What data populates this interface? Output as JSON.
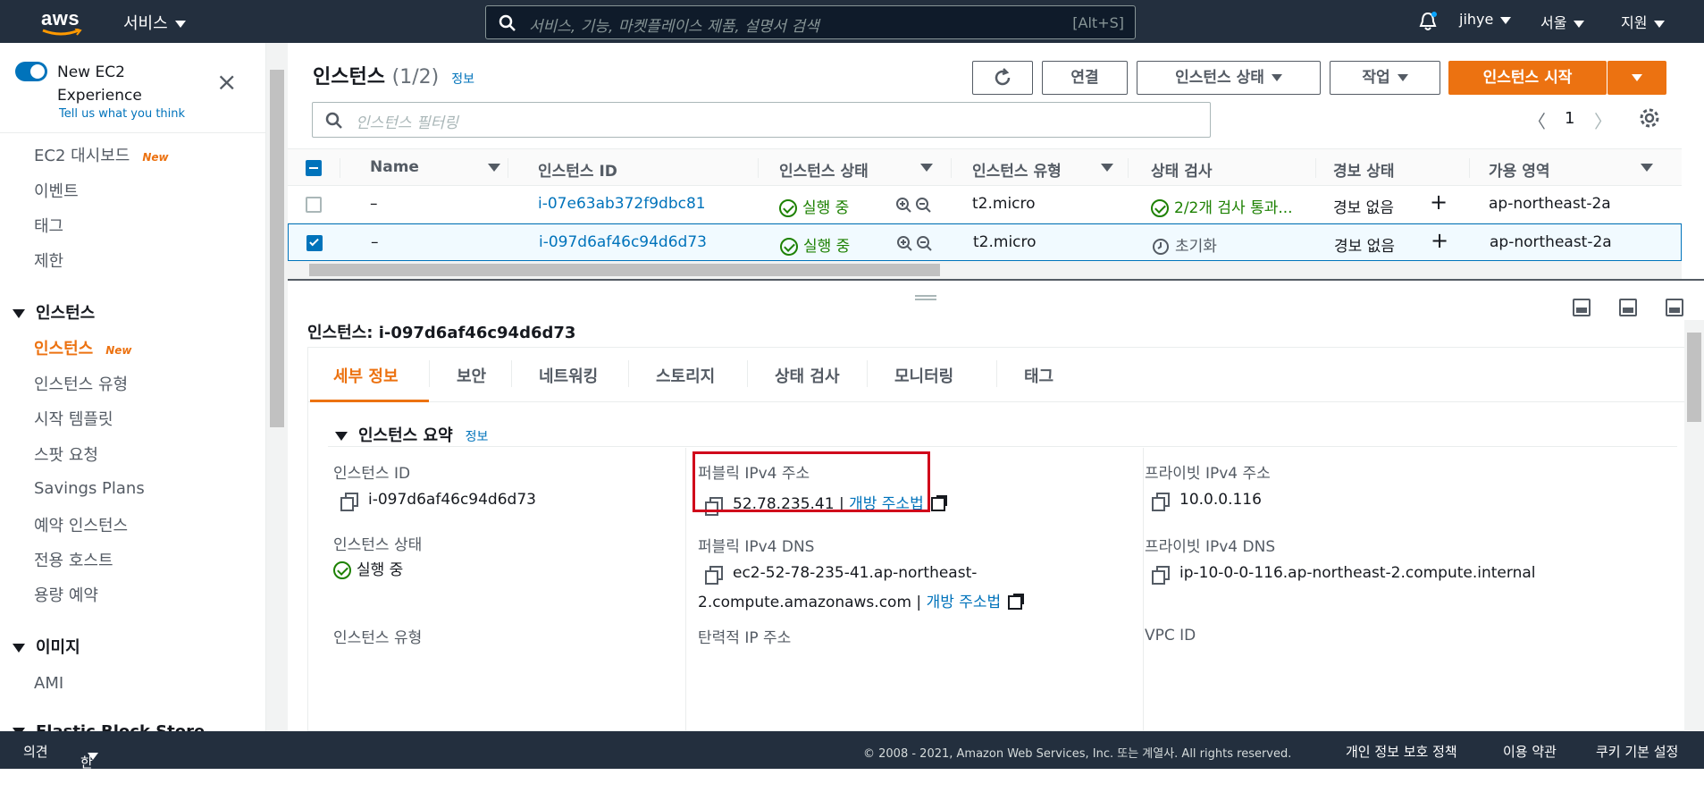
{
  "topbar": {
    "logo": "aws",
    "services_label": "서비스",
    "search_placeholder": "서비스, 기능, 마켓플레이스 제품, 설명서 검색",
    "search_shortcut": "[Alt+S]",
    "user": "jihye",
    "region": "서울",
    "support": "지원"
  },
  "sidebar": {
    "new_ec2": "New EC2 Experience",
    "tell_us": "Tell us what you think",
    "items": [
      {
        "label": "EC2 대시보드",
        "badge": "New"
      },
      {
        "label": "이벤트"
      },
      {
        "label": "태그"
      },
      {
        "label": "제한"
      }
    ],
    "section_instances": "인스턴스",
    "instance_items": [
      {
        "label": "인스턴스",
        "badge": "New"
      },
      {
        "label": "인스턴스 유형"
      },
      {
        "label": "시작 템플릿"
      },
      {
        "label": "스팟 요청"
      },
      {
        "label": "Savings Plans"
      },
      {
        "label": "예약 인스턴스"
      },
      {
        "label": "전용 호스트"
      },
      {
        "label": "용량 예약"
      }
    ],
    "section_images": "이미지",
    "image_items": [
      {
        "label": "AMI"
      }
    ],
    "section_ebs": "Elastic Block Store"
  },
  "main": {
    "title": "인스턴스",
    "count": "(1/2)",
    "info": "정보",
    "buttons": {
      "connect": "연결",
      "instance_state": "인스턴스 상태",
      "actions": "작업",
      "launch": "인스턴스 시작"
    },
    "filter_placeholder": "인스턴스 필터링",
    "page": "1",
    "columns": [
      "Name",
      "인스턴스 ID",
      "인스턴스 상태",
      "인스턴스 유형",
      "상태 검사",
      "경보 상태",
      "가용 영역"
    ],
    "rows": [
      {
        "name": "–",
        "id": "i-07e63ab372f9dbc81",
        "state": "실행 중",
        "type": "t2.micro",
        "check": "2/2개 검사 통과...",
        "alarm": "경보 없음",
        "az": "ap-northeast-2a",
        "selected": false
      },
      {
        "name": "–",
        "id": "i-097d6af46c94d6d73",
        "state": "실행 중",
        "type": "t2.micro",
        "check": "초기화",
        "alarm": "경보 없음",
        "az": "ap-northeast-2a",
        "selected": true
      }
    ]
  },
  "detail": {
    "title": "인스턴스: i-097d6af46c94d6d73",
    "tabs": [
      "세부 정보",
      "보안",
      "네트워킹",
      "스토리지",
      "상태 검사",
      "모니터링",
      "태그"
    ],
    "summary": "인스턴스 요약",
    "info": "정보",
    "fields": {
      "instance_id_label": "인스턴스 ID",
      "instance_id": "i-097d6af46c94d6d73",
      "public_ipv4_label": "퍼블릭 IPv4 주소",
      "public_ipv4": "52.78.235.41",
      "open_address": "개방 주소법",
      "private_ipv4_label": "프라이빗 IPv4 주소",
      "private_ipv4": "10.0.0.116",
      "instance_state_label": "인스턴스 상태",
      "instance_state": "실행 중",
      "public_dns_label": "퍼블릭 IPv4 DNS",
      "public_dns_1": "ec2-52-78-235-41.ap-northeast-",
      "public_dns_2": "2.compute.amazonaws.com",
      "private_dns_label": "프라이빗 IPv4 DNS",
      "private_dns": "ip-10-0-0-116.ap-northeast-2.compute.internal",
      "instance_type_label": "인스턴스 유형",
      "elastic_ip_label": "탄력적 IP 주소",
      "vpc_id_label": "VPC ID"
    }
  },
  "footer": {
    "feedback": "의견",
    "language": "한국어",
    "copyright": "© 2008 - 2021, Amazon Web Services, Inc. 또는 계열사. All rights reserved.",
    "privacy": "개인 정보 보호 정책",
    "terms": "이용 약관",
    "cookies": "쿠키 기본 설정"
  }
}
